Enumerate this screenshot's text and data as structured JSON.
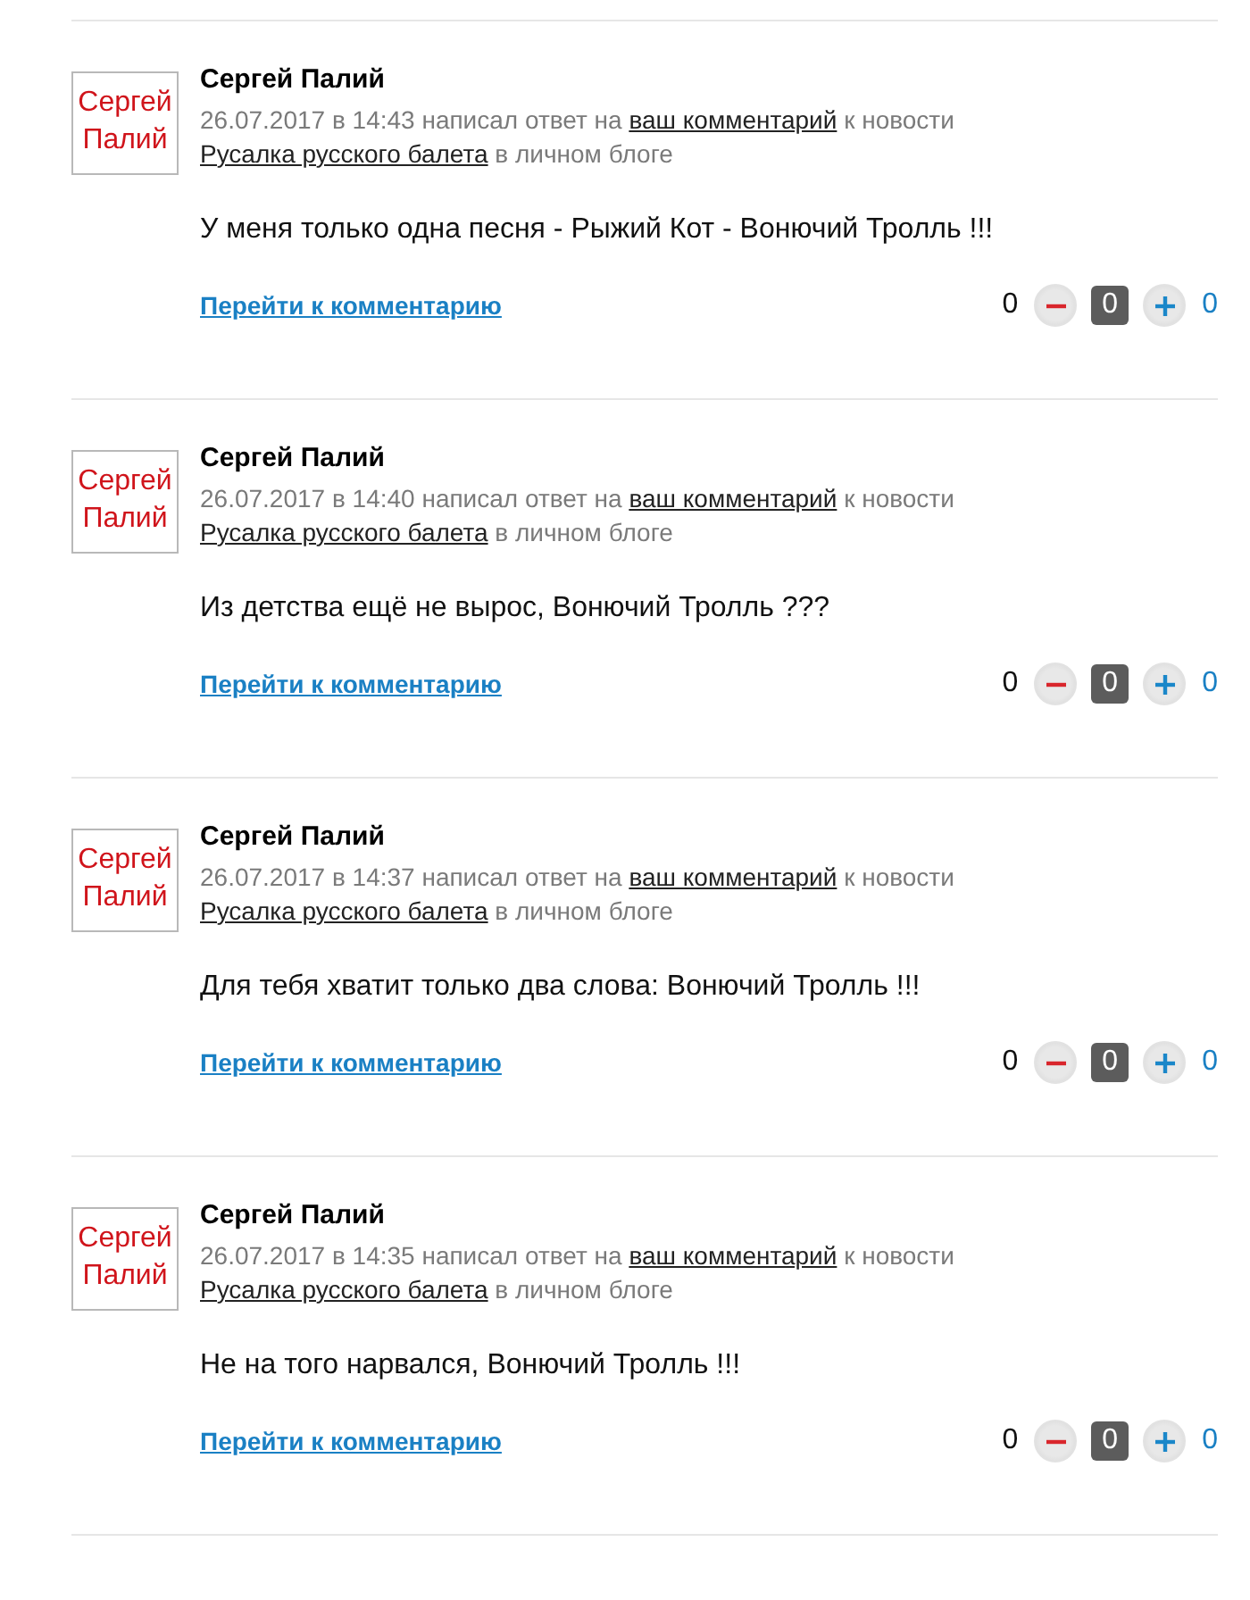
{
  "comments": [
    {
      "avatar_text": "Сергей Палий",
      "author": "Сергей Палий",
      "date": "26.07.2017 в 14:43",
      "action": "написал ответ на",
      "target_link": "ваш комментарий",
      "context": "к новости",
      "news_link": "Русалка русского балета",
      "place": "в личном блоге",
      "text": "У меня только одна песня - Рыжий Кот - Вонючий Тролль !!!",
      "goto_link": "Перейти к комментарию",
      "minus_count": "0",
      "score": "0",
      "plus_count": "0"
    },
    {
      "avatar_text": "Сергей Палий",
      "author": "Сергей Палий",
      "date": "26.07.2017 в 14:40",
      "action": "написал ответ на",
      "target_link": "ваш комментарий",
      "context": "к новости",
      "news_link": "Русалка русского балета",
      "place": "в личном блоге",
      "text": "Из детства ещё не вырос, Вонючий Тролль ???",
      "goto_link": "Перейти к комментарию",
      "minus_count": "0",
      "score": "0",
      "plus_count": "0"
    },
    {
      "avatar_text": "Сергей Палий",
      "author": "Сергей Палий",
      "date": "26.07.2017 в 14:37",
      "action": "написал ответ на",
      "target_link": "ваш комментарий",
      "context": "к новости",
      "news_link": "Русалка русского балета",
      "place": "в личном блоге",
      "text": "Для тебя хватит только два слова: Вонючий Тролль !!!",
      "goto_link": "Перейти к комментарию",
      "minus_count": "0",
      "score": "0",
      "plus_count": "0"
    },
    {
      "avatar_text": "Сергей Палий",
      "author": "Сергей Палий",
      "date": "26.07.2017 в 14:35",
      "action": "написал ответ на",
      "target_link": "ваш комментарий",
      "context": "к новости",
      "news_link": "Русалка русского балета",
      "place": "в личном блоге",
      "text": "Не на того нарвался, Вонючий Тролль !!!",
      "goto_link": "Перейти к комментарию",
      "minus_count": "0",
      "score": "0",
      "plus_count": "0"
    }
  ]
}
